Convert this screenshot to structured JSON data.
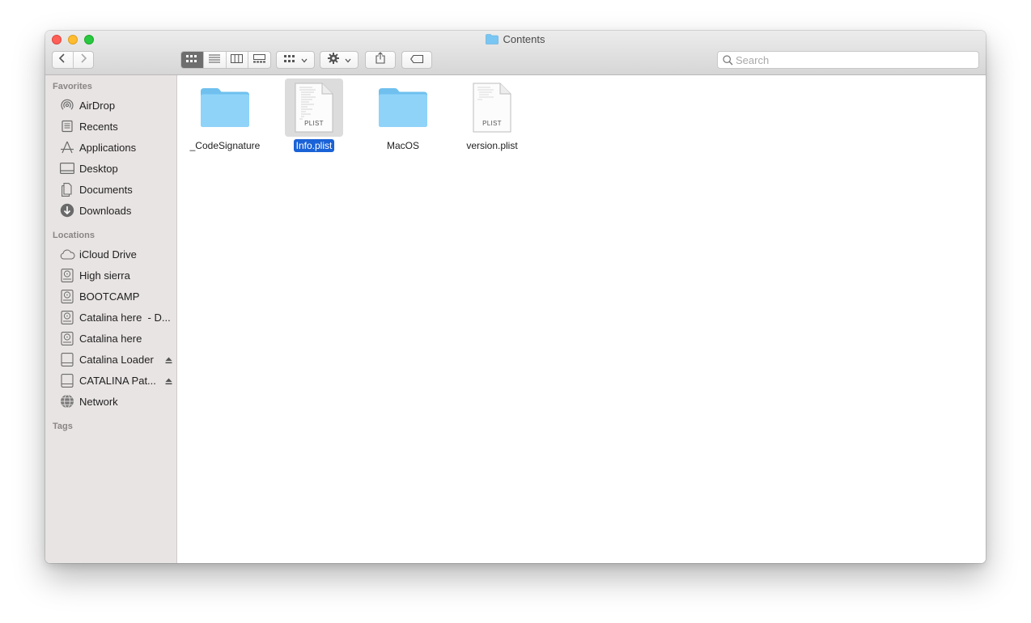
{
  "window": {
    "title": "Contents"
  },
  "toolbar": {
    "back_icon": "chevron-left-icon",
    "forward_icon": "chevron-right-icon",
    "views": [
      "icon-view",
      "list-view",
      "column-view",
      "gallery-view"
    ],
    "active_view": "icon-view",
    "group_icon": "group-icon",
    "action_icon": "gear-icon",
    "share_icon": "share-icon",
    "tag_icon": "tag-icon"
  },
  "search": {
    "placeholder": "Search",
    "value": ""
  },
  "sidebar": {
    "favorites_heading": "Favorites",
    "favorites": [
      {
        "label": "AirDrop",
        "icon": "airdrop-icon"
      },
      {
        "label": "Recents",
        "icon": "recents-icon"
      },
      {
        "label": "Applications",
        "icon": "applications-icon"
      },
      {
        "label": "Desktop",
        "icon": "desktop-icon"
      },
      {
        "label": "Documents",
        "icon": "documents-icon"
      },
      {
        "label": "Downloads",
        "icon": "downloads-icon"
      }
    ],
    "locations_heading": "Locations",
    "locations": [
      {
        "label": "iCloud Drive",
        "icon": "icloud-icon"
      },
      {
        "label": "High sierra",
        "icon": "disk-icon"
      },
      {
        "label": "BOOTCAMP",
        "icon": "disk-icon"
      },
      {
        "label": "Catalina here  - D...",
        "icon": "disk-icon"
      },
      {
        "label": "Catalina here",
        "icon": "disk-icon"
      },
      {
        "label": "Catalina Loader",
        "icon": "external-disk-icon",
        "eject": true
      },
      {
        "label": "CATALINA Pat...",
        "icon": "external-disk-icon",
        "eject": true
      },
      {
        "label": "Network",
        "icon": "network-icon"
      }
    ],
    "tags_heading": "Tags"
  },
  "files": [
    {
      "name": "_CodeSignature",
      "kind": "folder",
      "selected": false
    },
    {
      "name": "Info.plist",
      "kind": "plist",
      "badge": "PLIST",
      "selected": true
    },
    {
      "name": "MacOS",
      "kind": "folder",
      "selected": false
    },
    {
      "name": "version.plist",
      "kind": "plist",
      "badge": "PLIST",
      "selected": false
    }
  ],
  "colors": {
    "selection": "#1a62d7",
    "folder": "#7cc8f5",
    "sidebar_bg": "#e9e4e4"
  }
}
